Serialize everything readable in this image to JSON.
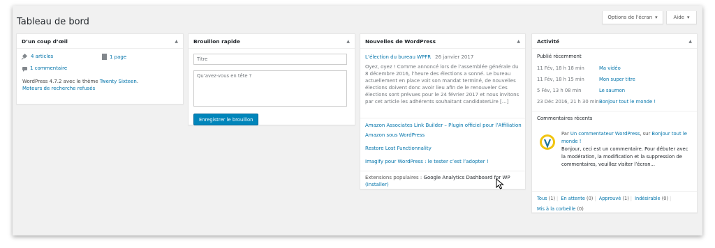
{
  "screen_options": {
    "label": "Options de l'écran",
    "help_label": "Aide"
  },
  "page": {
    "title": "Tableau de bord"
  },
  "glance": {
    "title": "D’un coup d’œil",
    "articles": "4 articles",
    "pages": "1 page",
    "comments": "1 commentaire",
    "version_prefix": "WordPress 4.7.2 avec le thème ",
    "theme": "Twenty Sixteen",
    "version_suffix": ".",
    "search_engines": "Moteurs de recherche refusés"
  },
  "quick_draft": {
    "title": "Brouillon rapide",
    "title_placeholder": "Titre",
    "content_placeholder": "Qu’avez-vous en tête ?",
    "save_button": "Enregistrer le brouillon"
  },
  "news": {
    "title": "Nouvelles de WordPress",
    "main": {
      "headline": "L’élection du bureau WPFR",
      "date": "26 janvier 2017",
      "body": "Oyez, oyez ! Comme annoncé lors de l’assemblée générale du 8 décembre 2016, l’heure des élections a sonné. Le bureau actuellement en place voit son mandat terminé, de nouvelles élections doivent donc avoir lieu afin de le renouveler  Ces élections sont prévues pour le 24 février 2017 et nous invitons par cet article les adhérents souhaitant candidaterLire […]"
    },
    "links": [
      "Amazon Associates Link Builder – Plugin officiel pour l’Affiliation",
      "Amazon sous WordPress",
      "Restore Lost Functionnality",
      "Imagify pour WordPress : le tester c’est l’adopter !"
    ],
    "popular_prefix": "Extensions populaires : ",
    "popular_name": "Google Analytics Dashboard for WP",
    "popular_install": "(Installer)"
  },
  "activity": {
    "title": "Activité",
    "recent_published": "Publié récemment",
    "rows": [
      {
        "date": "11 Fév, 18 h 18 min",
        "title": "Ma vidéo"
      },
      {
        "date": "11 Fév, 18 h 15 min",
        "title": "Mon super titre"
      },
      {
        "date": "5 Fév, 13 h 08 min",
        "title": "Le saumon"
      },
      {
        "date": "23 Déc 2016, 21 h 30 min",
        "title": "Bonjour tout le monde !"
      }
    ],
    "recent_comments": "Commentaires récents",
    "comment": {
      "by": "Par ",
      "author": "Un commentateur WordPress",
      "on": ", sur ",
      "post": "Bonjour tout le monde !",
      "text": "Bonjour, ceci est un commentaire. Pour débuter avec la modération, la modification et la suppression de commentaires, veuillez visiter l’écran..."
    },
    "filters": [
      {
        "label": "Tous",
        "count": "(1)"
      },
      {
        "label": "En attente",
        "count": "(0)"
      },
      {
        "label": "Approuvé",
        "count": "(1)"
      },
      {
        "label": "Indésirable",
        "count": "(0)"
      },
      {
        "label": "Mis à la corbeille",
        "count": "(0)"
      }
    ]
  }
}
